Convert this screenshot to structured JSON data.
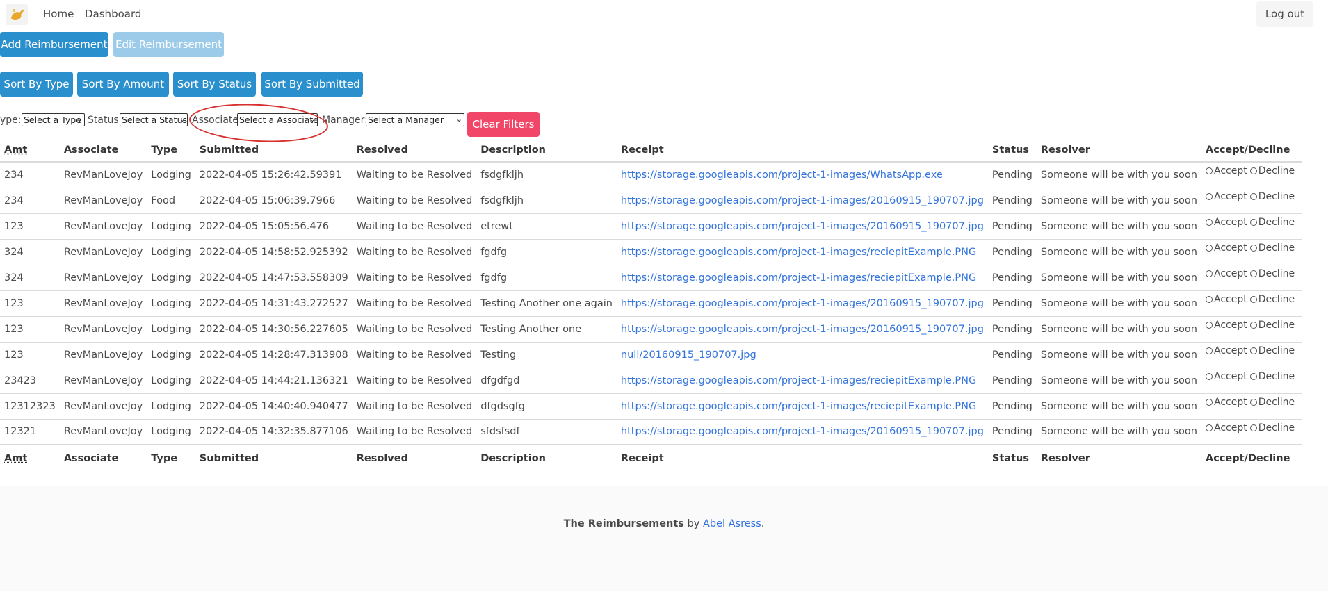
{
  "nav": {
    "logo_icon": "hand-logo-icon",
    "home": "Home",
    "dashboard": "Dashboard",
    "logout": "Log out"
  },
  "actions": {
    "add": "Add Reimbursement",
    "edit": "Edit Reimbursement"
  },
  "sort": {
    "type": "Sort By Type",
    "amount": "Sort By Amount",
    "status": "Sort By Status",
    "submitted": "Sort By Submitted"
  },
  "filters": {
    "type_label": "ype:",
    "type_value": "Select a Type",
    "status_label": "Status:",
    "status_value": "Select a Status",
    "associate_label": "Associate:",
    "associate_value": "Select a Associate",
    "manager_label": "Manager:",
    "manager_value": "Select a Manager",
    "clear": "Clear Filters"
  },
  "table": {
    "headers": [
      "Amt",
      "Associate",
      "Type",
      "Submitted",
      "Resolved",
      "Description",
      "Receipt",
      "Status",
      "Resolver",
      "Accept/Decline"
    ],
    "accept_label": "Accept",
    "decline_label": "Decline",
    "rows": [
      [
        "234",
        "RevManLoveJoy",
        "Lodging",
        "2022-04-05 15:26:42.59391",
        "Waiting to be Resolved",
        "fsdgfkljh",
        "https://storage.googleapis.com/project-1-images/WhatsApp.exe",
        "Pending",
        "Someone will be with you soon"
      ],
      [
        "234",
        "RevManLoveJoy",
        "Food",
        "2022-04-05 15:06:39.7966",
        "Waiting to be Resolved",
        "fsdgfkljh",
        "https://storage.googleapis.com/project-1-images/20160915_190707.jpg",
        "Pending",
        "Someone will be with you soon"
      ],
      [
        "123",
        "RevManLoveJoy",
        "Lodging",
        "2022-04-05 15:05:56.476",
        "Waiting to be Resolved",
        "etrewt",
        "https://storage.googleapis.com/project-1-images/20160915_190707.jpg",
        "Pending",
        "Someone will be with you soon"
      ],
      [
        "324",
        "RevManLoveJoy",
        "Lodging",
        "2022-04-05 14:58:52.925392",
        "Waiting to be Resolved",
        "fgdfg",
        "https://storage.googleapis.com/project-1-images/reciepitExample.PNG",
        "Pending",
        "Someone will be with you soon"
      ],
      [
        "324",
        "RevManLoveJoy",
        "Lodging",
        "2022-04-05 14:47:53.558309",
        "Waiting to be Resolved",
        "fgdfg",
        "https://storage.googleapis.com/project-1-images/reciepitExample.PNG",
        "Pending",
        "Someone will be with you soon"
      ],
      [
        "123",
        "RevManLoveJoy",
        "Lodging",
        "2022-04-05 14:31:43.272527",
        "Waiting to be Resolved",
        "Testing Another one again",
        "https://storage.googleapis.com/project-1-images/20160915_190707.jpg",
        "Pending",
        "Someone will be with you soon"
      ],
      [
        "123",
        "RevManLoveJoy",
        "Lodging",
        "2022-04-05 14:30:56.227605",
        "Waiting to be Resolved",
        "Testing Another one",
        "https://storage.googleapis.com/project-1-images/20160915_190707.jpg",
        "Pending",
        "Someone will be with you soon"
      ],
      [
        "123",
        "RevManLoveJoy",
        "Lodging",
        "2022-04-05 14:28:47.313908",
        "Waiting to be Resolved",
        "Testing",
        "null/20160915_190707.jpg",
        "Pending",
        "Someone will be with you soon"
      ],
      [
        "23423",
        "RevManLoveJoy",
        "Lodging",
        "2022-04-05 14:44:21.136321",
        "Waiting to be Resolved",
        "dfgdfgd",
        "https://storage.googleapis.com/project-1-images/reciepitExample.PNG",
        "Pending",
        "Someone will be with you soon"
      ],
      [
        "12312323",
        "RevManLoveJoy",
        "Lodging",
        "2022-04-05 14:40:40.940477",
        "Waiting to be Resolved",
        "dfgdsgfg",
        "https://storage.googleapis.com/project-1-images/reciepitExample.PNG",
        "Pending",
        "Someone will be with you soon"
      ],
      [
        "12321",
        "RevManLoveJoy",
        "Lodging",
        "2022-04-05 14:32:35.877106",
        "Waiting to be Resolved",
        "sfdsfsdf",
        "https://storage.googleapis.com/project-1-images/20160915_190707.jpg",
        "Pending",
        "Someone will be with you soon"
      ]
    ]
  },
  "footer": {
    "title": "The Reimbursements",
    "by": "by",
    "author": "Abel Asress",
    "period": "."
  },
  "colors": {
    "primary": "#2a8fcd",
    "primary_disabled": "#9ccbea",
    "danger": "#f14668",
    "link": "#3273dc",
    "annotation": "#d8302e"
  }
}
